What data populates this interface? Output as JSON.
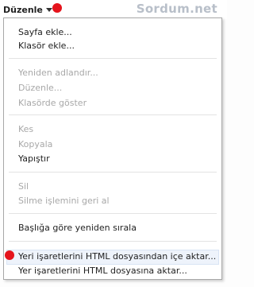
{
  "menu": {
    "title": "Düzenle",
    "sections": [
      [
        {
          "label": "Sayfa ekle...",
          "enabled": true
        },
        {
          "label": "Klasör ekle...",
          "enabled": true
        }
      ],
      [
        {
          "label": "Yeniden adlandır...",
          "enabled": false
        },
        {
          "label": "Düzenle...",
          "enabled": false
        },
        {
          "label": "Klasörde göster",
          "enabled": false
        }
      ],
      [
        {
          "label": "Kes",
          "enabled": false
        },
        {
          "label": "Kopyala",
          "enabled": false
        },
        {
          "label": "Yapıştır",
          "enabled": true
        }
      ],
      [
        {
          "label": "Sil",
          "enabled": false
        },
        {
          "label": "Silme işlemini geri al",
          "enabled": false
        }
      ],
      [
        {
          "label": "Başlığa göre yeniden sırala",
          "enabled": true
        }
      ],
      [
        {
          "label": "Yeri işaretlerini HTML dosyasından içe aktar...",
          "enabled": true,
          "highlighted": true
        },
        {
          "label": "Yer işaretlerini HTML dosyasına aktar...",
          "enabled": true
        }
      ]
    ]
  },
  "watermark": "Sordum.net",
  "colors": {
    "marker_dot": "#e5141c",
    "disabled_text": "#a8a8a8",
    "enabled_text": "#222222",
    "highlight_bg": "#eef3fb"
  }
}
